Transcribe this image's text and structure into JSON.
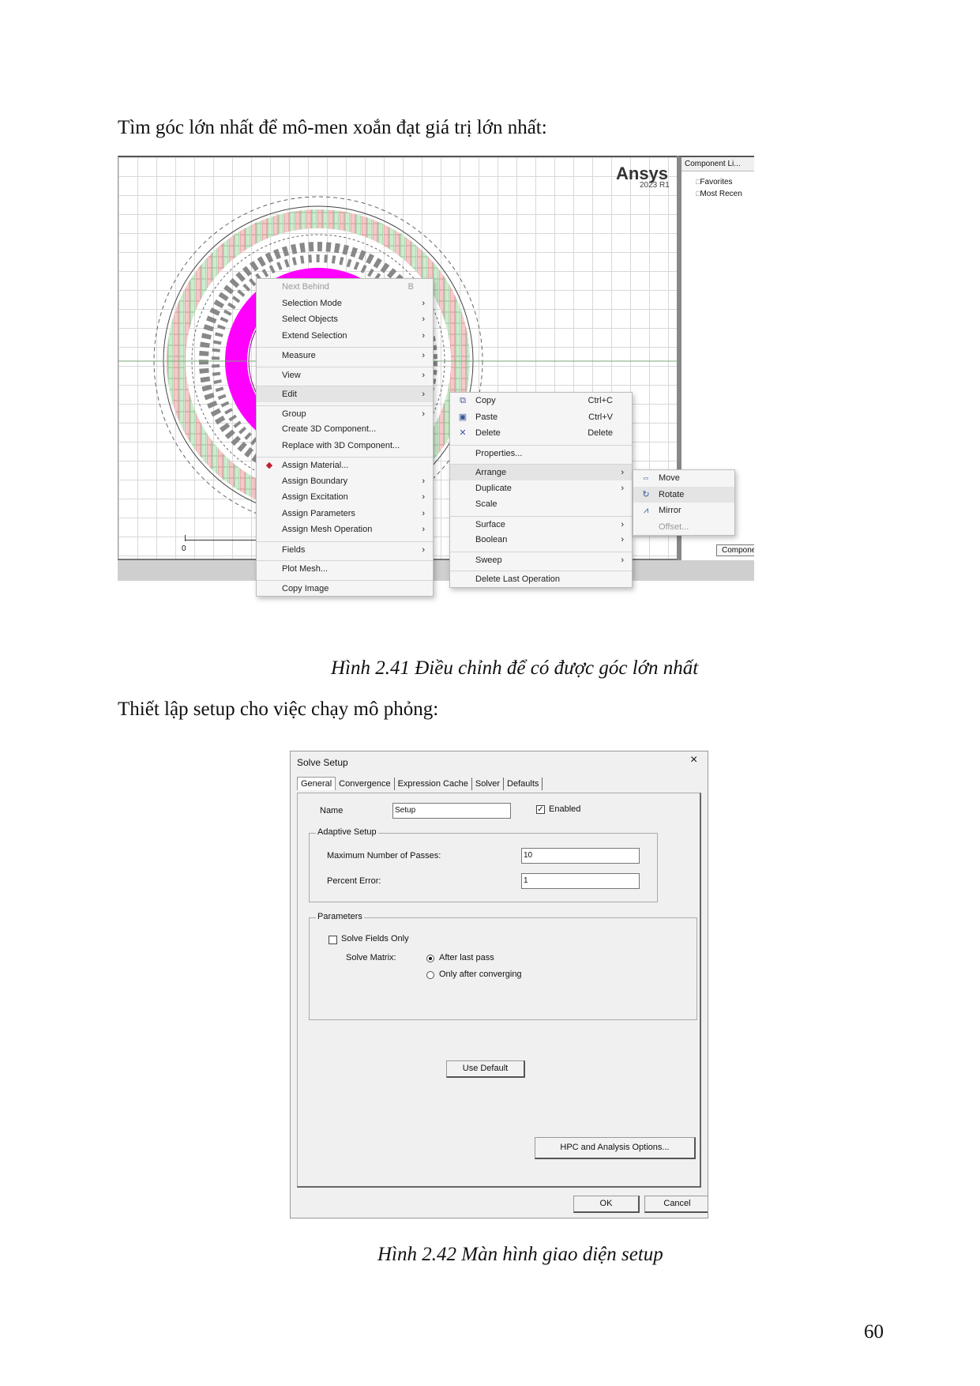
{
  "text": {
    "para1": "Tìm góc lớn nhất để mô-men xoắn đạt giá trị lớn nhất:",
    "caption1": "Hình 2.41 Điều chỉnh để có được góc lớn nhất",
    "para2": "Thiết lập setup cho việc chạy mô phỏng:",
    "caption2": "Hình 2.42 Màn hình giao diện setup",
    "page_number": "60"
  },
  "figure1": {
    "logo": "Ansys",
    "logo_version": "2023 R1",
    "scale_zero": "0",
    "right_panel": {
      "title": "Component Li...",
      "items": [
        "Favorites",
        "Most Recen"
      ],
      "tab": "Components"
    },
    "context_menu": [
      {
        "label": "Next Behind",
        "shortcut": "B",
        "disabled": true
      },
      {
        "label": "Selection Mode",
        "submenu": true
      },
      {
        "label": "Select Objects",
        "submenu": true
      },
      {
        "label": "Extend Selection",
        "submenu": true
      },
      {
        "label": "Measure",
        "submenu": true,
        "sep": true
      },
      {
        "label": "View",
        "submenu": true,
        "sep": true
      },
      {
        "label": "Edit",
        "submenu": true,
        "sep": true,
        "highlight": true
      },
      {
        "label": "Group",
        "submenu": true,
        "sep": true
      },
      {
        "label": "Create 3D Component..."
      },
      {
        "label": "Replace with 3D Component..."
      },
      {
        "label": "Assign Material...",
        "sep": true,
        "icon": "material-icon"
      },
      {
        "label": "Assign Boundary",
        "submenu": true
      },
      {
        "label": "Assign Excitation",
        "submenu": true
      },
      {
        "label": "Assign Parameters",
        "submenu": true
      },
      {
        "label": "Assign Mesh Operation",
        "submenu": true
      },
      {
        "label": "Fields",
        "submenu": true,
        "sep": true
      },
      {
        "label": "Plot Mesh...",
        "sep": true
      },
      {
        "label": "Copy Image",
        "sep": true
      }
    ],
    "edit_submenu": [
      {
        "label": "Copy",
        "shortcut": "Ctrl+C",
        "icon": "copy-icon"
      },
      {
        "label": "Paste",
        "shortcut": "Ctrl+V",
        "icon": "paste-icon"
      },
      {
        "label": "Delete",
        "shortcut": "Delete",
        "icon": "delete-icon"
      },
      {
        "label": "Properties...",
        "sep": true
      },
      {
        "label": "Arrange",
        "submenu": true,
        "sep": true,
        "highlight": true
      },
      {
        "label": "Duplicate",
        "submenu": true
      },
      {
        "label": "Scale"
      },
      {
        "label": "Surface",
        "submenu": true,
        "sep": true
      },
      {
        "label": "Boolean",
        "submenu": true
      },
      {
        "label": "Sweep",
        "submenu": true,
        "sep": true
      },
      {
        "label": "Delete Last Operation",
        "sep": true
      }
    ],
    "arrange_submenu": [
      {
        "label": "Move",
        "icon": "move-icon"
      },
      {
        "label": "Rotate",
        "icon": "rotate-icon",
        "highlight": true
      },
      {
        "label": "Mirror",
        "icon": "mirror-icon"
      },
      {
        "label": "Offset...",
        "disabled": true
      }
    ]
  },
  "figure2": {
    "title": "Solve Setup",
    "close": "×",
    "tabs": [
      "General",
      "Convergence",
      "Expression Cache",
      "Solver",
      "Defaults"
    ],
    "name_label": "Name",
    "name_value": "Setup",
    "enabled_label": "Enabled",
    "adaptive_group": "Adaptive Setup",
    "max_passes_label": "Maximum Number of Passes:",
    "max_passes_value": "10",
    "percent_error_label": "Percent Error:",
    "percent_error_value": "1",
    "parameters_group": "Parameters",
    "solve_fields_only": "Solve Fields Only",
    "solve_matrix_label": "Solve Matrix:",
    "radio_after_last": "After last pass",
    "radio_only_after": "Only after converging",
    "use_default": "Use Default",
    "hpc_button": "HPC and Analysis Options...",
    "ok": "OK",
    "cancel": "Cancel"
  }
}
